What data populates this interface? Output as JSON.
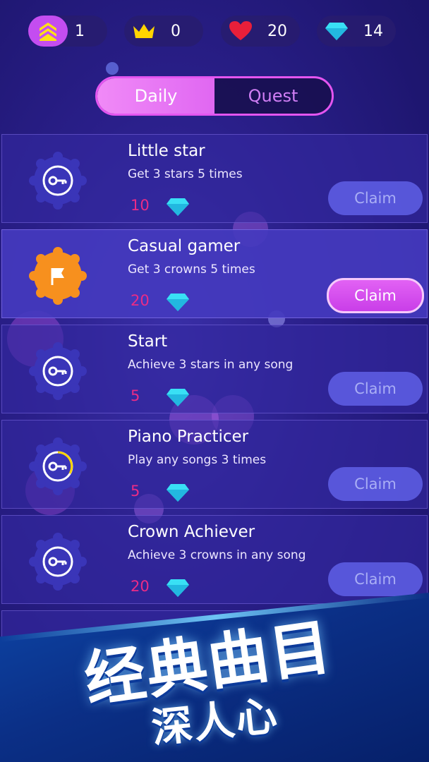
{
  "status": {
    "level": {
      "icon": "rank-chevrons-icon",
      "value": "1"
    },
    "crowns": {
      "icon": "crown-icon",
      "value": "0"
    },
    "lives": {
      "icon": "heart-icon",
      "value": "20"
    },
    "gems": {
      "icon": "diamond-icon",
      "value": "14"
    }
  },
  "tabs": [
    {
      "label": "Daily",
      "active": true
    },
    {
      "label": "Quest",
      "active": false
    }
  ],
  "quests": [
    {
      "title": "Little star",
      "description": "Get 3 stars 5 times",
      "reward": "10",
      "claim_label": "Claim",
      "claimable": false,
      "badge": "key-badge-icon",
      "progress": 0
    },
    {
      "title": "Casual gamer",
      "description": "Get 3 crowns 5 times",
      "reward": "20",
      "claim_label": "Claim",
      "claimable": true,
      "badge": "flag-badge-icon",
      "progress": 1
    },
    {
      "title": "Start",
      "description": "Achieve 3 stars in any song",
      "reward": "5",
      "claim_label": "Claim",
      "claimable": false,
      "badge": "key-badge-icon",
      "progress": 0
    },
    {
      "title": "Piano Practicer",
      "description": "Play any songs 3 times",
      "reward": "5",
      "claim_label": "Claim",
      "claimable": false,
      "badge": "key-badge-icon",
      "progress": 0.33
    },
    {
      "title": "Crown Achiever",
      "description": "Achieve 3 crowns in any song",
      "reward": "20",
      "claim_label": "Claim",
      "claimable": false,
      "badge": "key-badge-icon",
      "progress": 0
    }
  ],
  "banner": {
    "line1": "经典曲目",
    "line2": "深人心"
  },
  "colors": {
    "accent": "#e067f2",
    "reward": "#ea2c86",
    "gem": "#39e0f5",
    "badge_active": "#f7901e"
  }
}
